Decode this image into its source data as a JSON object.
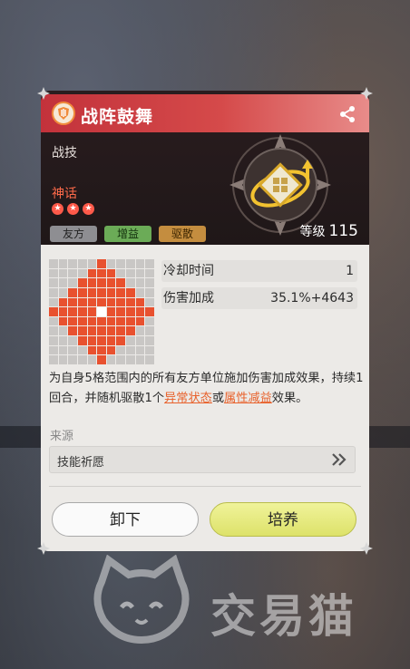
{
  "skill": {
    "title": "战阵鼓舞",
    "category": "战技",
    "rarity": "神话",
    "stars": 3,
    "tags": [
      "友方",
      "增益",
      "驱散"
    ],
    "level_label": "等级",
    "level": "115"
  },
  "stats": [
    {
      "label": "冷却时间",
      "value": "1"
    },
    {
      "label": "伤害加成",
      "value": "35.1%+4643"
    }
  ],
  "description": {
    "part1": "为自身5格范围内的所有友方单位施加伤害加成效果，持续1回合，并随机驱散1个",
    "highlight1": "异常状态",
    "part2": "或",
    "highlight2": "属性减益",
    "part3": "效果。"
  },
  "source": {
    "label": "来源",
    "value": "技能祈愿"
  },
  "buttons": {
    "unequip": "卸下",
    "develop": "培养"
  },
  "watermark": "交易猫",
  "colors": {
    "title_bar": "#d54a4a",
    "range_on": "#e8512f",
    "highlight": "#e8612b",
    "develop_button": "#e6ea7c"
  },
  "icons": [
    "skill-type-icon",
    "share-icon",
    "skill-emblem-icon",
    "chevron-double-right-icon",
    "cat-logo-icon"
  ]
}
